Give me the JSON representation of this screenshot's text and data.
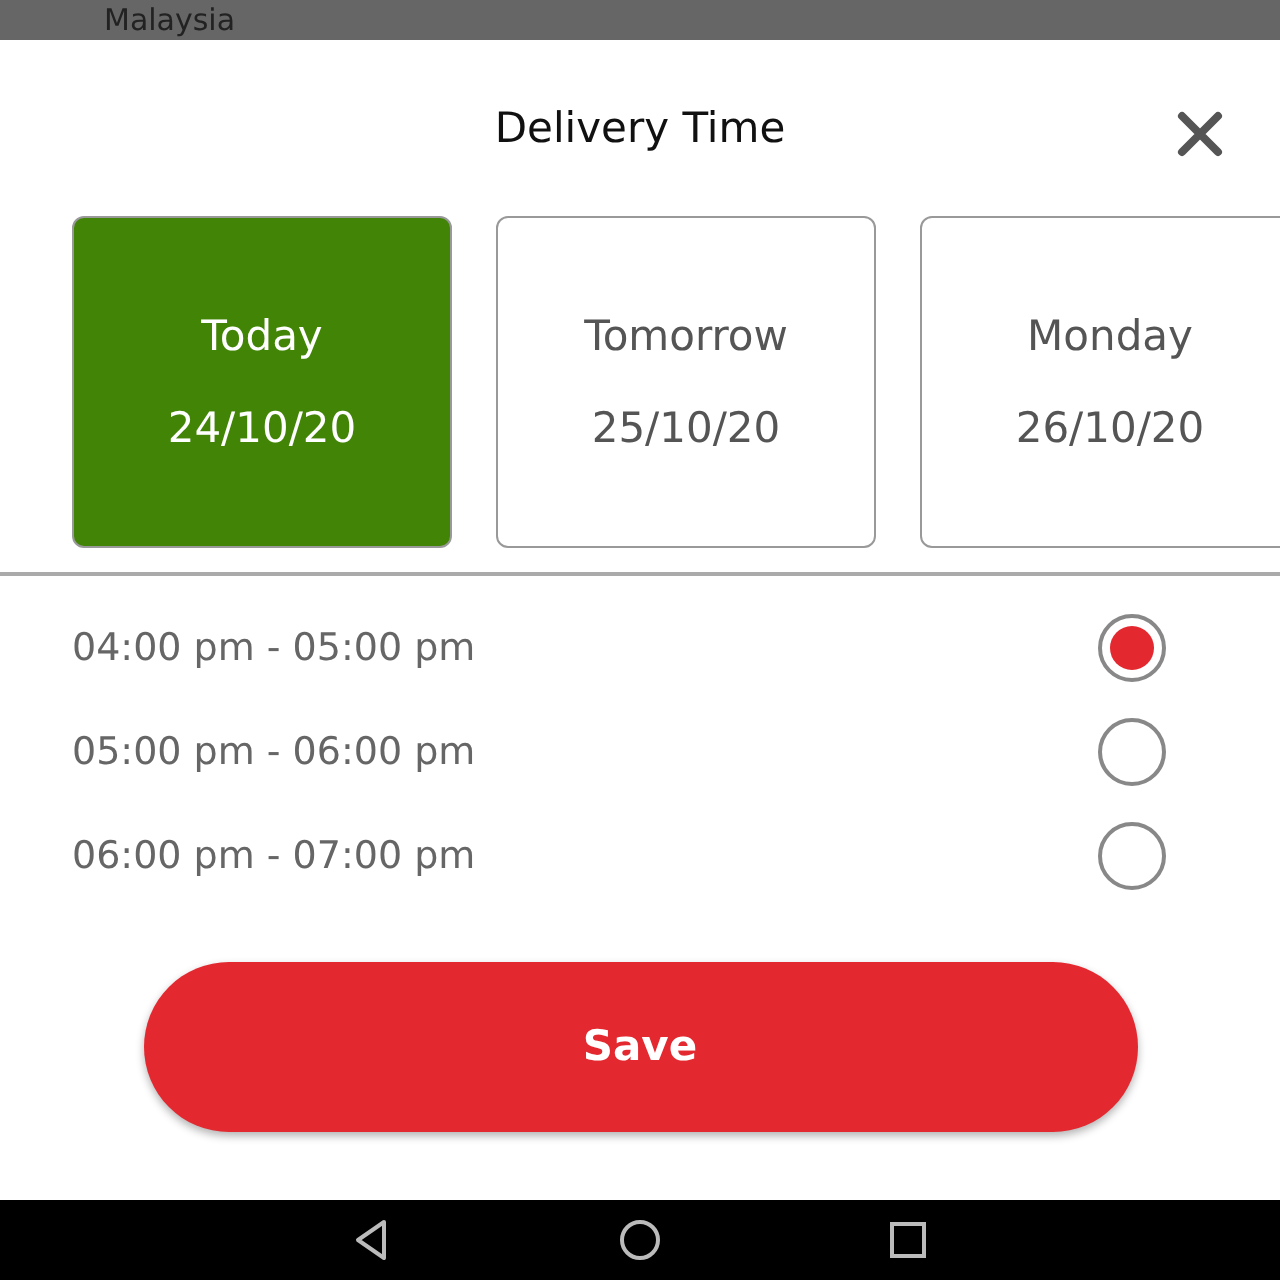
{
  "background": {
    "text": "Malaysia"
  },
  "dialog": {
    "title": "Delivery Time",
    "dates": [
      {
        "day": "Today",
        "date": "24/10/20",
        "selected": true
      },
      {
        "day": "Tomorrow",
        "date": "25/10/20",
        "selected": false
      },
      {
        "day": "Monday",
        "date": "26/10/20",
        "selected": false
      }
    ],
    "slots": [
      {
        "label": "04:00 pm - 05:00 pm",
        "selected": true
      },
      {
        "label": "05:00 pm - 06:00 pm",
        "selected": false
      },
      {
        "label": "06:00 pm - 07:00 pm",
        "selected": false
      }
    ],
    "save_button": "Save"
  }
}
